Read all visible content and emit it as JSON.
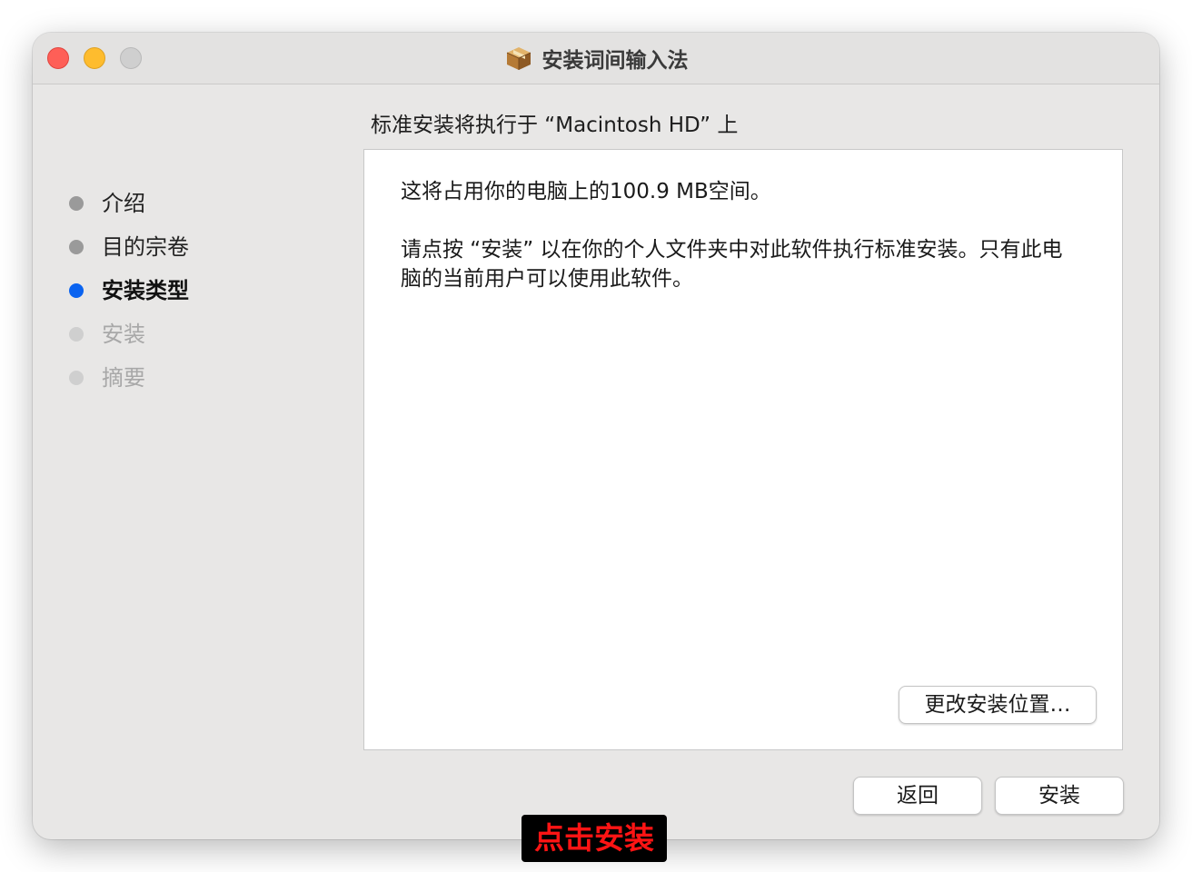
{
  "window": {
    "title": "安装词间输入法",
    "icon": "package-icon"
  },
  "sidebar": {
    "steps": [
      {
        "label": "介绍",
        "state": "done"
      },
      {
        "label": "目的宗卷",
        "state": "done"
      },
      {
        "label": "安装类型",
        "state": "active"
      },
      {
        "label": "安装",
        "state": "future"
      },
      {
        "label": "摘要",
        "state": "future"
      }
    ]
  },
  "content": {
    "heading": "标准安装将执行于 “Macintosh HD” 上",
    "paragraph1": "这将占用你的电脑上的100.9 MB空间。",
    "paragraph2": "请点按 “安装” 以在你的个人文件夹中对此软件执行标准安装。只有此电脑的当前用户可以使用此软件。",
    "change_location_label": "更改安装位置…"
  },
  "footer": {
    "back_label": "返回",
    "install_label": "安装"
  },
  "overlay": {
    "caption": "点击安装"
  },
  "colors": {
    "active_step": "#0a63f0",
    "close": "#fe5f57",
    "minimize": "#febc2e",
    "zoom_inactive": "#cfcfcf",
    "caption_text": "#ff1414",
    "caption_bg": "#000000"
  }
}
